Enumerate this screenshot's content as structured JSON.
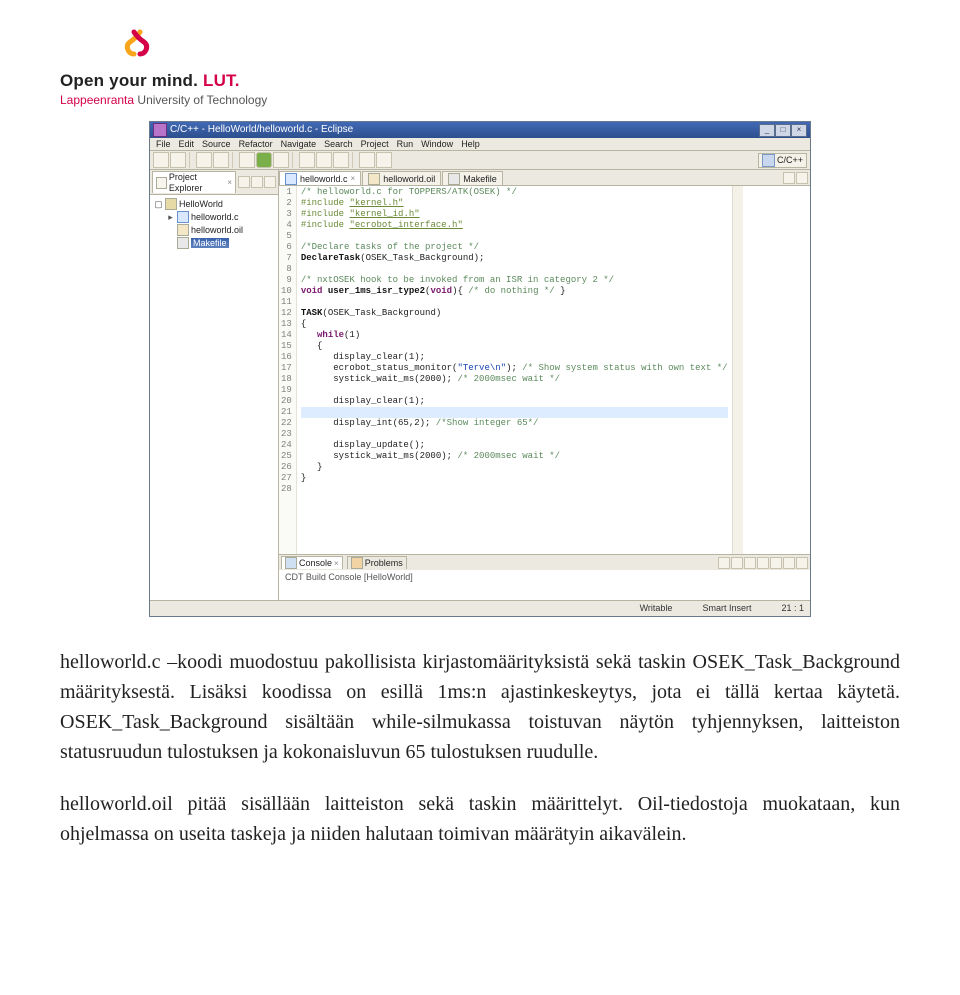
{
  "logo": {
    "slogan_left": "Open your mind.",
    "slogan_right": "LUT.",
    "university_highlight": "Lappeenranta",
    "university_rest": " University of Technology"
  },
  "eclipse": {
    "title": "C/C++ - HelloWorld/helloworld.c - Eclipse",
    "winbtns": {
      "min": "_",
      "max": "□",
      "close": "×"
    },
    "menu": [
      "File",
      "Edit",
      "Source",
      "Refactor",
      "Navigate",
      "Search",
      "Project",
      "Run",
      "Window",
      "Help"
    ],
    "perspective": "C/C++",
    "explorer": {
      "tab": "Project Explorer",
      "project": "HelloWorld",
      "files": [
        "helloworld.c",
        "helloworld.oil",
        "Makefile"
      ]
    },
    "editor_tabs": [
      "helloworld.c",
      "helloworld.oil",
      "Makefile"
    ],
    "code_lines": [
      "/* helloworld.c for TOPPERS/ATK(OSEK) */",
      "#include \"kernel.h\"",
      "#include \"kernel_id.h\"",
      "#include \"ecrobot_interface.h\"",
      "",
      "/*Declare tasks of the project */",
      "DeclareTask(OSEK_Task_Background);",
      "",
      "/* nxtOSEK hook to be invoked from an ISR in category 2 */",
      "void user_1ms_isr_type2(void){ /* do nothing */ }",
      "",
      "TASK(OSEK_Task_Background)",
      "{",
      "   while(1)",
      "   {",
      "      display_clear(1);",
      "      ecrobot_status_monitor(\"Terve\\n\"); /* Show system status with own text */",
      "      systick_wait_ms(2000); /* 2000msec wait */",
      "",
      "      display_clear(1);",
      "",
      "      display_int(65,2); /*Show integer 65*/",
      "",
      "      display_update();",
      "      systick_wait_ms(2000); /* 2000msec wait */",
      "   }",
      "}",
      ""
    ],
    "console": {
      "tab1": "Console",
      "tab2": "Problems",
      "body": "CDT Build Console [HelloWorld]"
    },
    "status": {
      "mode": "Writable",
      "insert": "Smart Insert",
      "pos": "21 : 1"
    }
  },
  "paragraphs": {
    "p1": "helloworld.c –koodi muodostuu pakollisista kirjastomäärityksistä sekä taskin OSEK_Task_Background määrityksestä. Lisäksi koodissa on esillä 1ms:n ajastinkeskeytys, jota ei tällä kertaa käytetä. OSEK_Task_Background sisältään while-silmukassa toistuvan näytön tyhjennyksen, laitteiston statusruudun tulostuksen ja kokonaisluvun 65 tulostuksen ruudulle.",
    "p2": "helloworld.oil pitää sisällään laitteiston sekä taskin määrittelyt. Oil-tiedostoja muokataan, kun ohjelmassa on useita taskeja ja niiden halutaan toimivan määrätyin aikavälein."
  }
}
